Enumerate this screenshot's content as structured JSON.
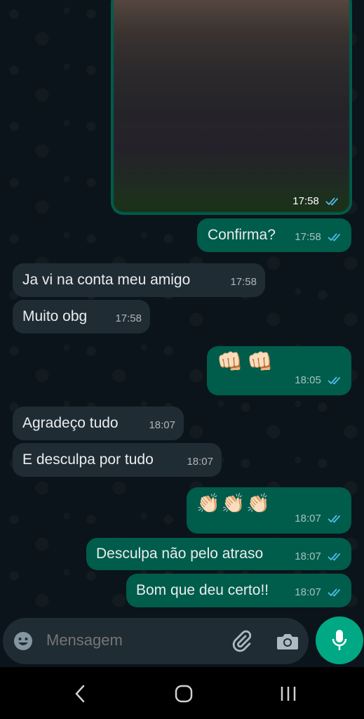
{
  "colors": {
    "outgoing_bubble": "#005c4b",
    "incoming_bubble": "#202c33",
    "read_ticks": "#53bdeb",
    "accent": "#00a884",
    "background": "#0b141a"
  },
  "messages": [
    {
      "direction": "out",
      "type": "image",
      "time": "17:58",
      "status": "read"
    },
    {
      "direction": "out",
      "type": "text",
      "text": "Confirma?",
      "time": "17:58",
      "status": "read"
    },
    {
      "direction": "in",
      "type": "text",
      "text": "Ja vi na conta meu amigo",
      "time": "17:58"
    },
    {
      "direction": "in",
      "type": "text",
      "text": "Muito obg",
      "time": "17:58"
    },
    {
      "direction": "out",
      "type": "emoji",
      "text": "👊🏻👊🏻",
      "time": "18:05",
      "status": "read"
    },
    {
      "direction": "in",
      "type": "text",
      "text": "Agradeço tudo",
      "time": "18:07"
    },
    {
      "direction": "in",
      "type": "text",
      "text": "E desculpa por tudo",
      "time": "18:07"
    },
    {
      "direction": "out",
      "type": "emoji",
      "text": "👏🏻👏🏻👏🏻",
      "time": "18:07",
      "status": "read"
    },
    {
      "direction": "out",
      "type": "text",
      "text": "Desculpa não pelo atraso",
      "time": "18:07",
      "status": "read"
    },
    {
      "direction": "out",
      "type": "text",
      "text": "Bom que deu certo!!",
      "time": "18:07",
      "status": "read"
    }
  ],
  "composer": {
    "placeholder": "Mensagem",
    "icons": [
      "emoji-icon",
      "attach-icon",
      "camera-icon",
      "mic-icon"
    ]
  },
  "navbar": {
    "icons": [
      "back-icon",
      "home-icon",
      "recents-icon"
    ]
  }
}
